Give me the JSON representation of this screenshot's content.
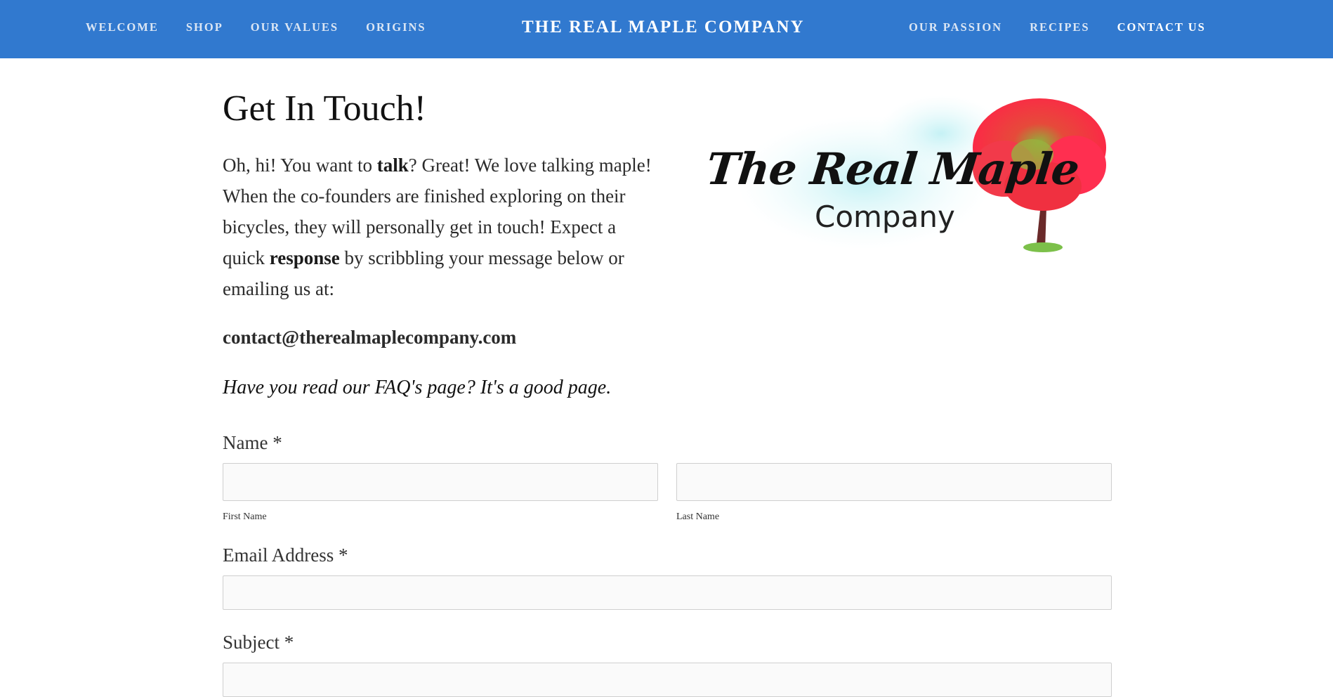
{
  "header": {
    "brand": "THE REAL MAPLE COMPANY",
    "nav_left": [
      "WELCOME",
      "SHOP",
      "OUR VALUES",
      "ORIGINS"
    ],
    "nav_right": [
      "OUR PASSION",
      "RECIPES",
      "CONTACT US"
    ],
    "active": "CONTACT US",
    "bg_color": "#3179cf"
  },
  "content": {
    "heading": "Get In Touch!",
    "intro": {
      "p1": "Oh, hi! You want to ",
      "b1": "talk",
      "p2": "? Great! We love talking maple! When the co-founders are finished exploring on their bicycles, they will personally get in touch! Expect a quick ",
      "b2": "response",
      "p3": " by scribbling your message below or emailing us at:"
    },
    "email": "contact@therealmaplecompany.com",
    "faq": "Have you read our FAQ's page? It's a good page."
  },
  "logo": {
    "line1": "The Real Maple",
    "line2": "Company"
  },
  "form": {
    "name_label": "Name *",
    "first_name_label": "First Name",
    "last_name_label": "Last Name",
    "email_label": "Email Address *",
    "subject_label": "Subject *",
    "first_name_value": "",
    "last_name_value": "",
    "email_value": "",
    "subject_value": ""
  }
}
